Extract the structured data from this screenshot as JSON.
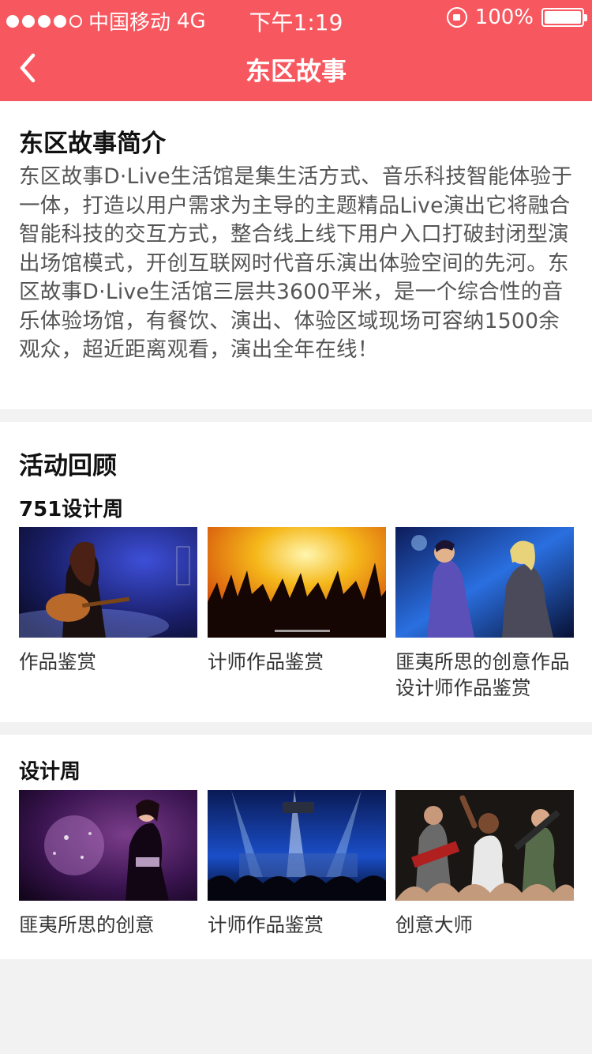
{
  "status_bar": {
    "carrier": "中国移动",
    "network": "4G",
    "time": "下午1:19",
    "battery": "100%"
  },
  "nav": {
    "title": "东区故事"
  },
  "intro": {
    "title": "东区故事简介",
    "body": "东区故事D·Live生活馆是集生活方式、音乐科技智能体验于一体，打造以用户需求为主导的主题精品Live演出它将融合智能科技的交互方式，整合线上线下用户入口打破封闭型演出场馆模式，开创互联网时代音乐演出体验空间的先河。东区故事D·Live生活馆三层共3600平米，是一个综合性的音乐体验场馆，有餐饮、演出、体验区域现场可容纳1500余观众，超近距离观看，演出全年在线！"
  },
  "review": {
    "title": "活动回顾",
    "group_title": "751设计周",
    "cards": [
      {
        "title": "作品鉴赏",
        "image": "guitar-singer-photo"
      },
      {
        "title": "计师作品鉴赏",
        "image": "concert-crowd-photo"
      },
      {
        "title": "匪夷所思的创意作品设计师作品鉴赏",
        "image": "duet-singers-photo"
      }
    ]
  },
  "week": {
    "group_title": "设计周",
    "cards": [
      {
        "title": "匪夷所思的创意",
        "image": "dancer-glitter-photo"
      },
      {
        "title": "计师作品鉴赏",
        "image": "stage-lights-photo"
      },
      {
        "title": "创意大师",
        "image": "band-fans-photo"
      }
    ]
  },
  "colors": {
    "accent": "#f7585f",
    "background": "#f2f2f2"
  }
}
